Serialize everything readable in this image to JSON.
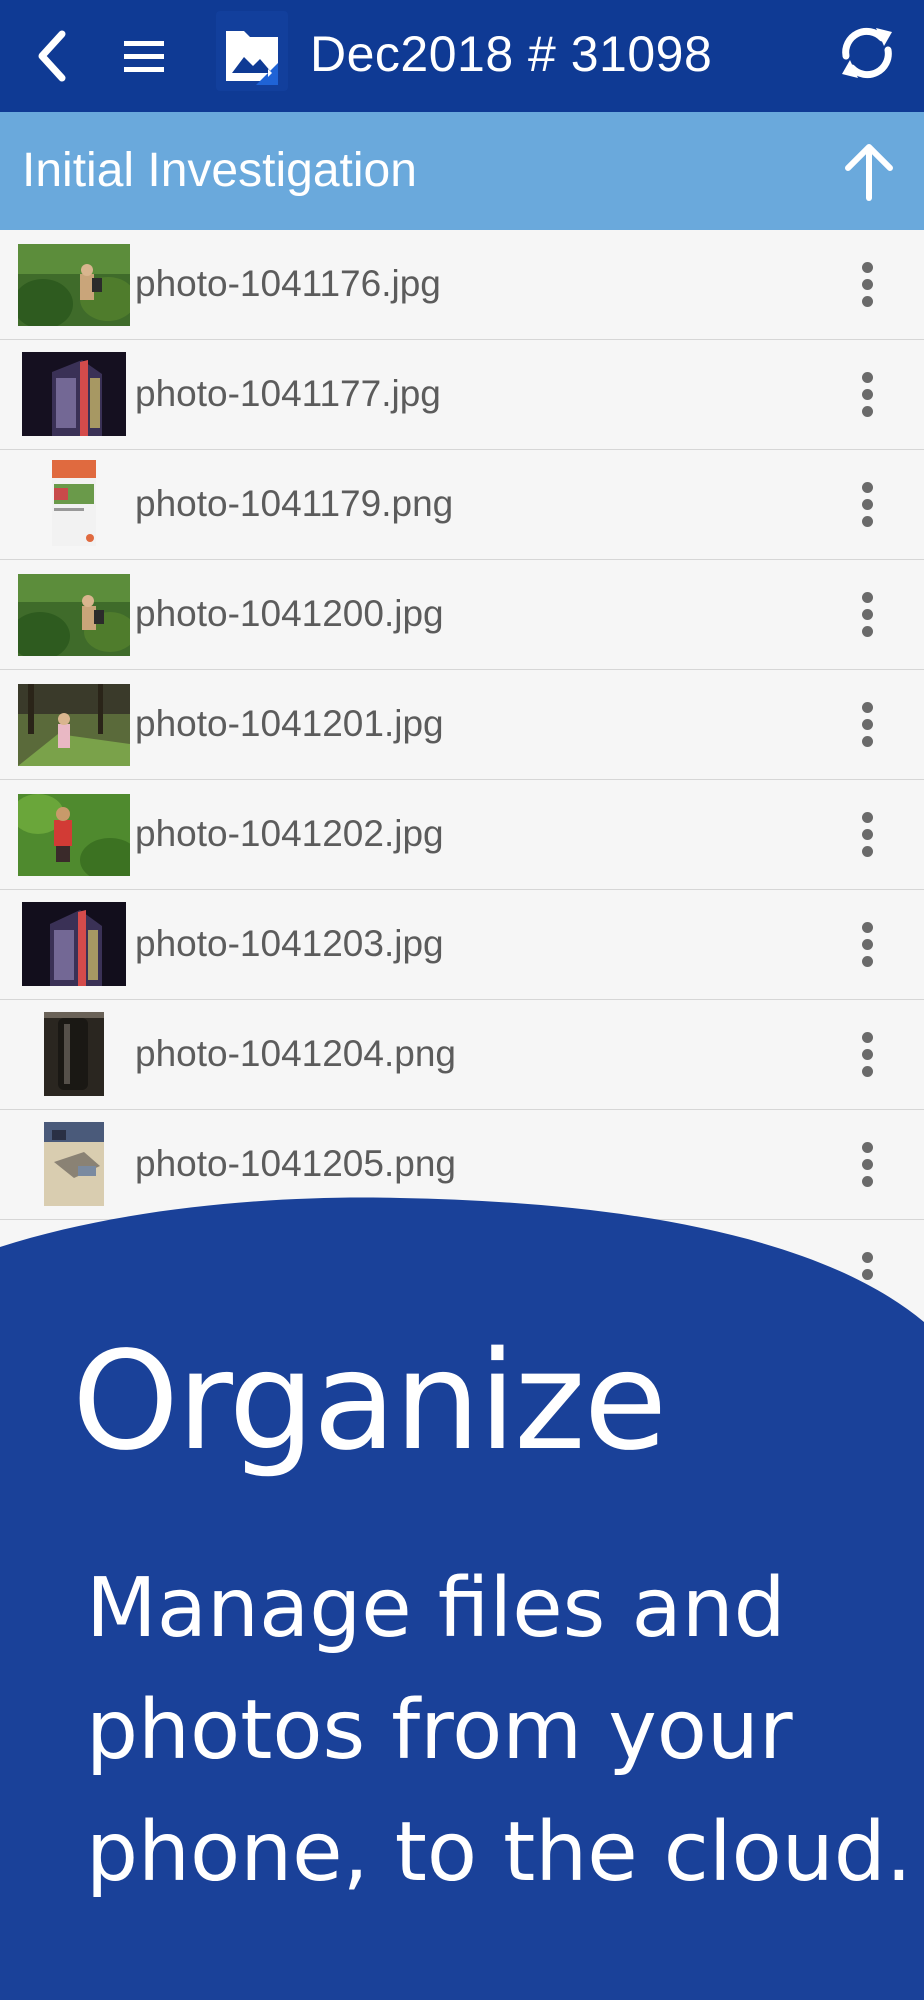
{
  "topbar": {
    "title": "Dec2018 # 31098",
    "icons": [
      "back-icon",
      "menu-icon",
      "app-folder-icon",
      "sync-icon"
    ]
  },
  "subheader": {
    "label": "Initial Investigation",
    "icon": "arrow-up-icon"
  },
  "files": [
    {
      "name": "photo-1041176.jpg"
    },
    {
      "name": "photo-1041177.jpg"
    },
    {
      "name": "photo-1041179.png"
    },
    {
      "name": "photo-1041200.jpg"
    },
    {
      "name": "photo-1041201.jpg"
    },
    {
      "name": "photo-1041202.jpg"
    },
    {
      "name": "photo-1041203.jpg"
    },
    {
      "name": "photo-1041204.png"
    },
    {
      "name": "photo-1041205.png"
    }
  ],
  "promo": {
    "title": "Organize",
    "body": "Manage files and photos from your phone, to the cloud."
  },
  "colors": {
    "topbar": "#0f3a94",
    "subheader": "#6aa9dc",
    "promo": "#1a4199",
    "list_bg": "#f6f6f6"
  }
}
